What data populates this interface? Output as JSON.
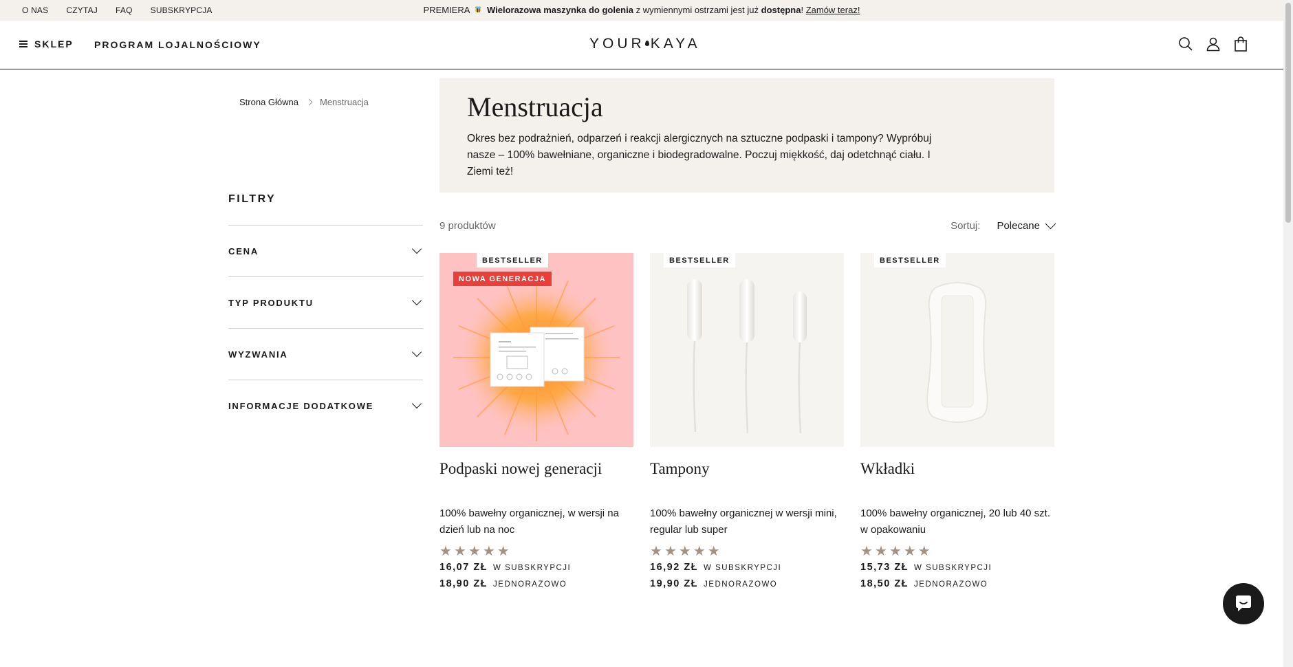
{
  "topbar": {
    "links": [
      "O NAS",
      "CZYTAJ",
      "FAQ",
      "SUBSKRYPCJA"
    ],
    "promo_prefix": "PREMIERA",
    "promo_bold1": "Wielorazowa maszynka do golenia",
    "promo_mid": "z wymiennymi ostrzami jest już",
    "promo_bold2": "dostępna",
    "promo_end": "!",
    "promo_link": "Zamów teraz!"
  },
  "header": {
    "menu_label": "SKLEP",
    "loyalty_label": "PROGRAM LOJALNOŚCIOWY",
    "logo_left": "YOUR",
    "logo_right": "KAYA",
    "icons": [
      "search-icon",
      "account-icon",
      "cart-icon"
    ]
  },
  "breadcrumb": {
    "home": "Strona Główna",
    "current": "Menstruacja"
  },
  "filters": {
    "title": "FILTRY",
    "items": [
      "CENA",
      "TYP PRODUKTU",
      "WYZWANIA",
      "INFORMACJE DODATKOWE"
    ]
  },
  "hero": {
    "title": "Menstruacja",
    "description": "Okres bez podrażnień, odparzeń i reakcji alergicznych na sztuczne podpaski i tampony? Wypróbuj nasze – 100% bawełniane, organiczne i biodegradowalne. Poczuj miękkość, daj odetchnąć ciału. I Ziemi też!"
  },
  "listing": {
    "count": "9 produktów",
    "sort_label": "Sortuj:",
    "sort_value": "Polecane"
  },
  "products": [
    {
      "badges": [
        "BESTSELLER",
        "NOWA GENERACJA"
      ],
      "name": "Podpaski nowej generacji",
      "desc": "100% bawełny organicznej, w wersji na dzień lub na noc",
      "rating": 5,
      "price_sub": "16,07 ZŁ",
      "price_sub_label": "W SUBSKRYPCJI",
      "price_once": "18,90 ZŁ",
      "price_once_label": "JEDNORAZOWO"
    },
    {
      "badges": [
        "BESTSELLER"
      ],
      "name": "Tampony",
      "desc": "100% bawełny organicznej w wersji mini, regular lub super",
      "rating": 5,
      "price_sub": "16,92 ZŁ",
      "price_sub_label": "W SUBSKRYPCJI",
      "price_once": "19,90 ZŁ",
      "price_once_label": "JEDNORAZOWO"
    },
    {
      "badges": [
        "BESTSELLER"
      ],
      "name": "Wkładki",
      "desc": "100% bawełny organicznej, 20 lub 40 szt. w opakowaniu",
      "rating": 5,
      "price_sub": "15,73 ZŁ",
      "price_sub_label": "W SUBSKRYPCJI",
      "price_once": "18,50 ZŁ",
      "price_once_label": "JEDNORAZOWO"
    }
  ],
  "colors": {
    "beige": "#f4f1ed",
    "badge_red": "#e83f3b",
    "star": "#a39181",
    "pink": "#ffc2c2",
    "orange": "#ff8a1e"
  }
}
